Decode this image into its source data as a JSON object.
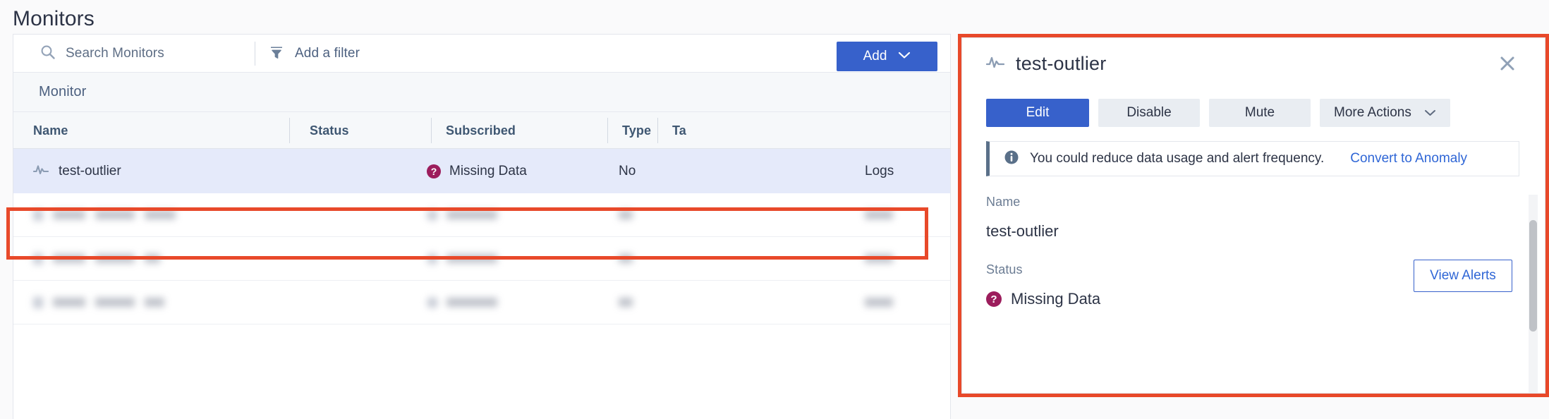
{
  "page": {
    "title": "Monitors"
  },
  "toolbar": {
    "search_placeholder": "Search Monitors",
    "search_icon": "search-icon",
    "filter_label": "Add a filter",
    "filter_icon": "filter-icon",
    "add_label": "Add",
    "add_caret_icon": "chevron-down-icon",
    "add_color": "#3761cb"
  },
  "group_header": {
    "label": "Monitor"
  },
  "table": {
    "columns": [
      "Name",
      "Status",
      "Subscribed",
      "Type",
      "Ta"
    ],
    "rows": [
      {
        "name": "test-outlier",
        "icon": "monitor-pulse-icon",
        "status": "Missing Data",
        "status_icon": "question-circle-icon",
        "status_color": "#9c1d5c",
        "subscribed": "No",
        "type": "Logs",
        "selected": true,
        "redacted": false
      },
      {
        "name": "",
        "status": "",
        "subscribed": "",
        "type": "",
        "selected": false,
        "redacted": true
      },
      {
        "name": "",
        "status": "",
        "subscribed": "",
        "type": "",
        "selected": false,
        "redacted": true
      },
      {
        "name": "",
        "status": "",
        "subscribed": "",
        "type": "",
        "selected": false,
        "redacted": true
      }
    ]
  },
  "detail_panel": {
    "title": "test-outlier",
    "title_icon": "monitor-pulse-icon",
    "close_icon": "close-icon",
    "actions": {
      "edit": "Edit",
      "disable": "Disable",
      "mute": "Mute",
      "more": "More Actions",
      "more_caret_icon": "chevron-down-icon"
    },
    "banner": {
      "icon": "info-circle-icon",
      "text": "You could reduce data usage and alert frequency.",
      "link": "Convert to Anomaly",
      "accent_color": "#5a7089",
      "link_color": "#2f66d6"
    },
    "fields": {
      "name_label": "Name",
      "name_value": "test-outlier",
      "status_label": "Status",
      "status_value": "Missing Data",
      "status_icon": "question-circle-icon",
      "status_color": "#9c1d5c"
    },
    "view_alerts_label": "View Alerts",
    "scrollbar": "vertical-scrollbar"
  },
  "annotations": {
    "row_highlight_color": "#e8492a",
    "panel_highlight_color": "#e8492a"
  }
}
